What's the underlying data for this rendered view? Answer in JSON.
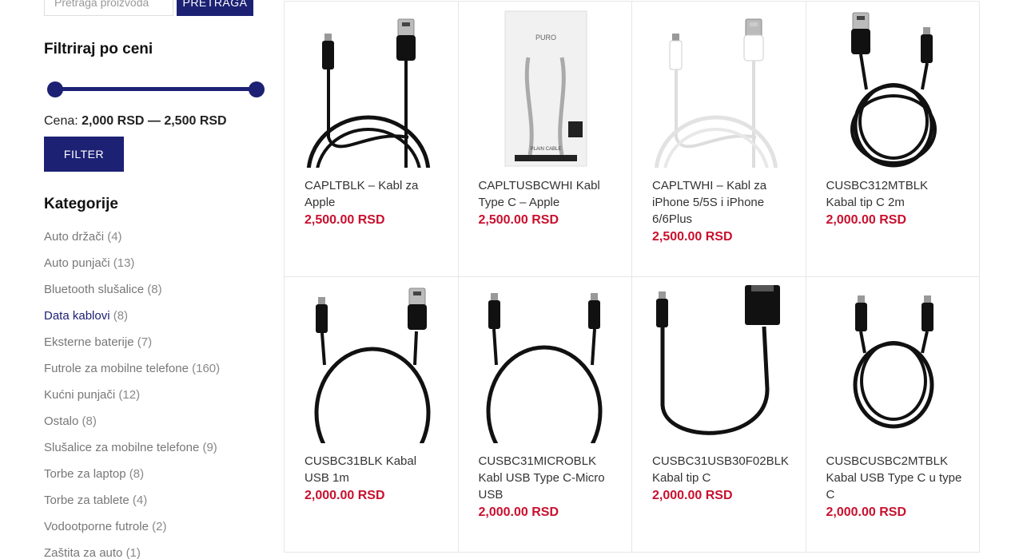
{
  "search": {
    "placeholder": "Pretraga proizvoda",
    "button_label": "PRETRAGA"
  },
  "price_filter": {
    "title": "Filtriraj po ceni",
    "price_prefix": "Cena:",
    "min_price": "2,000 RSD",
    "separator": "—",
    "max_price": "2,500 RSD",
    "slider_min_fraction": 0.0,
    "slider_max_fraction": 1.0,
    "button_label": "FILTER"
  },
  "categories": {
    "title": "Kategorije",
    "items": [
      {
        "label": "Auto držači",
        "count": "(4)"
      },
      {
        "label": "Auto punjači",
        "count": "(13)"
      },
      {
        "label": "Bluetooth slušalice",
        "count": "(8)"
      },
      {
        "label": "Data kablovi",
        "count": "(8)",
        "active": true
      },
      {
        "label": "Eksterne baterije",
        "count": "(7)"
      },
      {
        "label": "Futrole za mobilne telefone",
        "count": "(160)"
      },
      {
        "label": "Kućni punjači",
        "count": "(12)"
      },
      {
        "label": "Ostalo",
        "count": "(8)"
      },
      {
        "label": "Slušalice za mobilne telefone",
        "count": "(9)"
      },
      {
        "label": "Torbe za laptop",
        "count": "(8)"
      },
      {
        "label": "Torbe za tablete",
        "count": "(4)"
      },
      {
        "label": "Vodootporne futrole",
        "count": "(2)"
      },
      {
        "label": "Zaštita za auto",
        "count": "(1)"
      }
    ]
  },
  "products": [
    {
      "title": "CAPLTBLK – Kabl za Apple",
      "price": "2,500.00 RSD",
      "image": "cable-lightning-black"
    },
    {
      "title": "CAPLTUSBCWHI Kabl Type C – Apple",
      "price": "2,500.00 RSD",
      "image": "cable-packaged-white",
      "package_brand": "PURO",
      "package_label": "PLAIN CABLE"
    },
    {
      "title": "CAPLTWHI – Kabl za iPhone 5/5S i iPhone 6/6Plus",
      "price": "2,500.00 RSD",
      "image": "cable-lightning-white"
    },
    {
      "title": "CUSBC312MTBLK Kabal tip C 2m",
      "price": "2,000.00 RSD",
      "image": "cable-coiled-black"
    },
    {
      "title": "CUSBC31BLK Kabal USB 1m",
      "price": "2,000.00 RSD",
      "image": "cable-usb-black"
    },
    {
      "title": "CUSBC31MICROBLK Kabl USB Type C-Micro USB",
      "price": "2,000.00 RSD",
      "image": "cable-micro-black"
    },
    {
      "title": "CUSBC31USB30F02BLK Kabal tip C",
      "price": "2,000.00 RSD",
      "image": "cable-otg-black"
    },
    {
      "title": "CUSBCUSBC2MTBLK Kabal USB Type C u type C",
      "price": "2,000.00 RSD",
      "image": "cable-typec-coiled-black"
    }
  ],
  "colors": {
    "accent": "#1c2174",
    "price": "#c8102e",
    "text": "#333333"
  }
}
